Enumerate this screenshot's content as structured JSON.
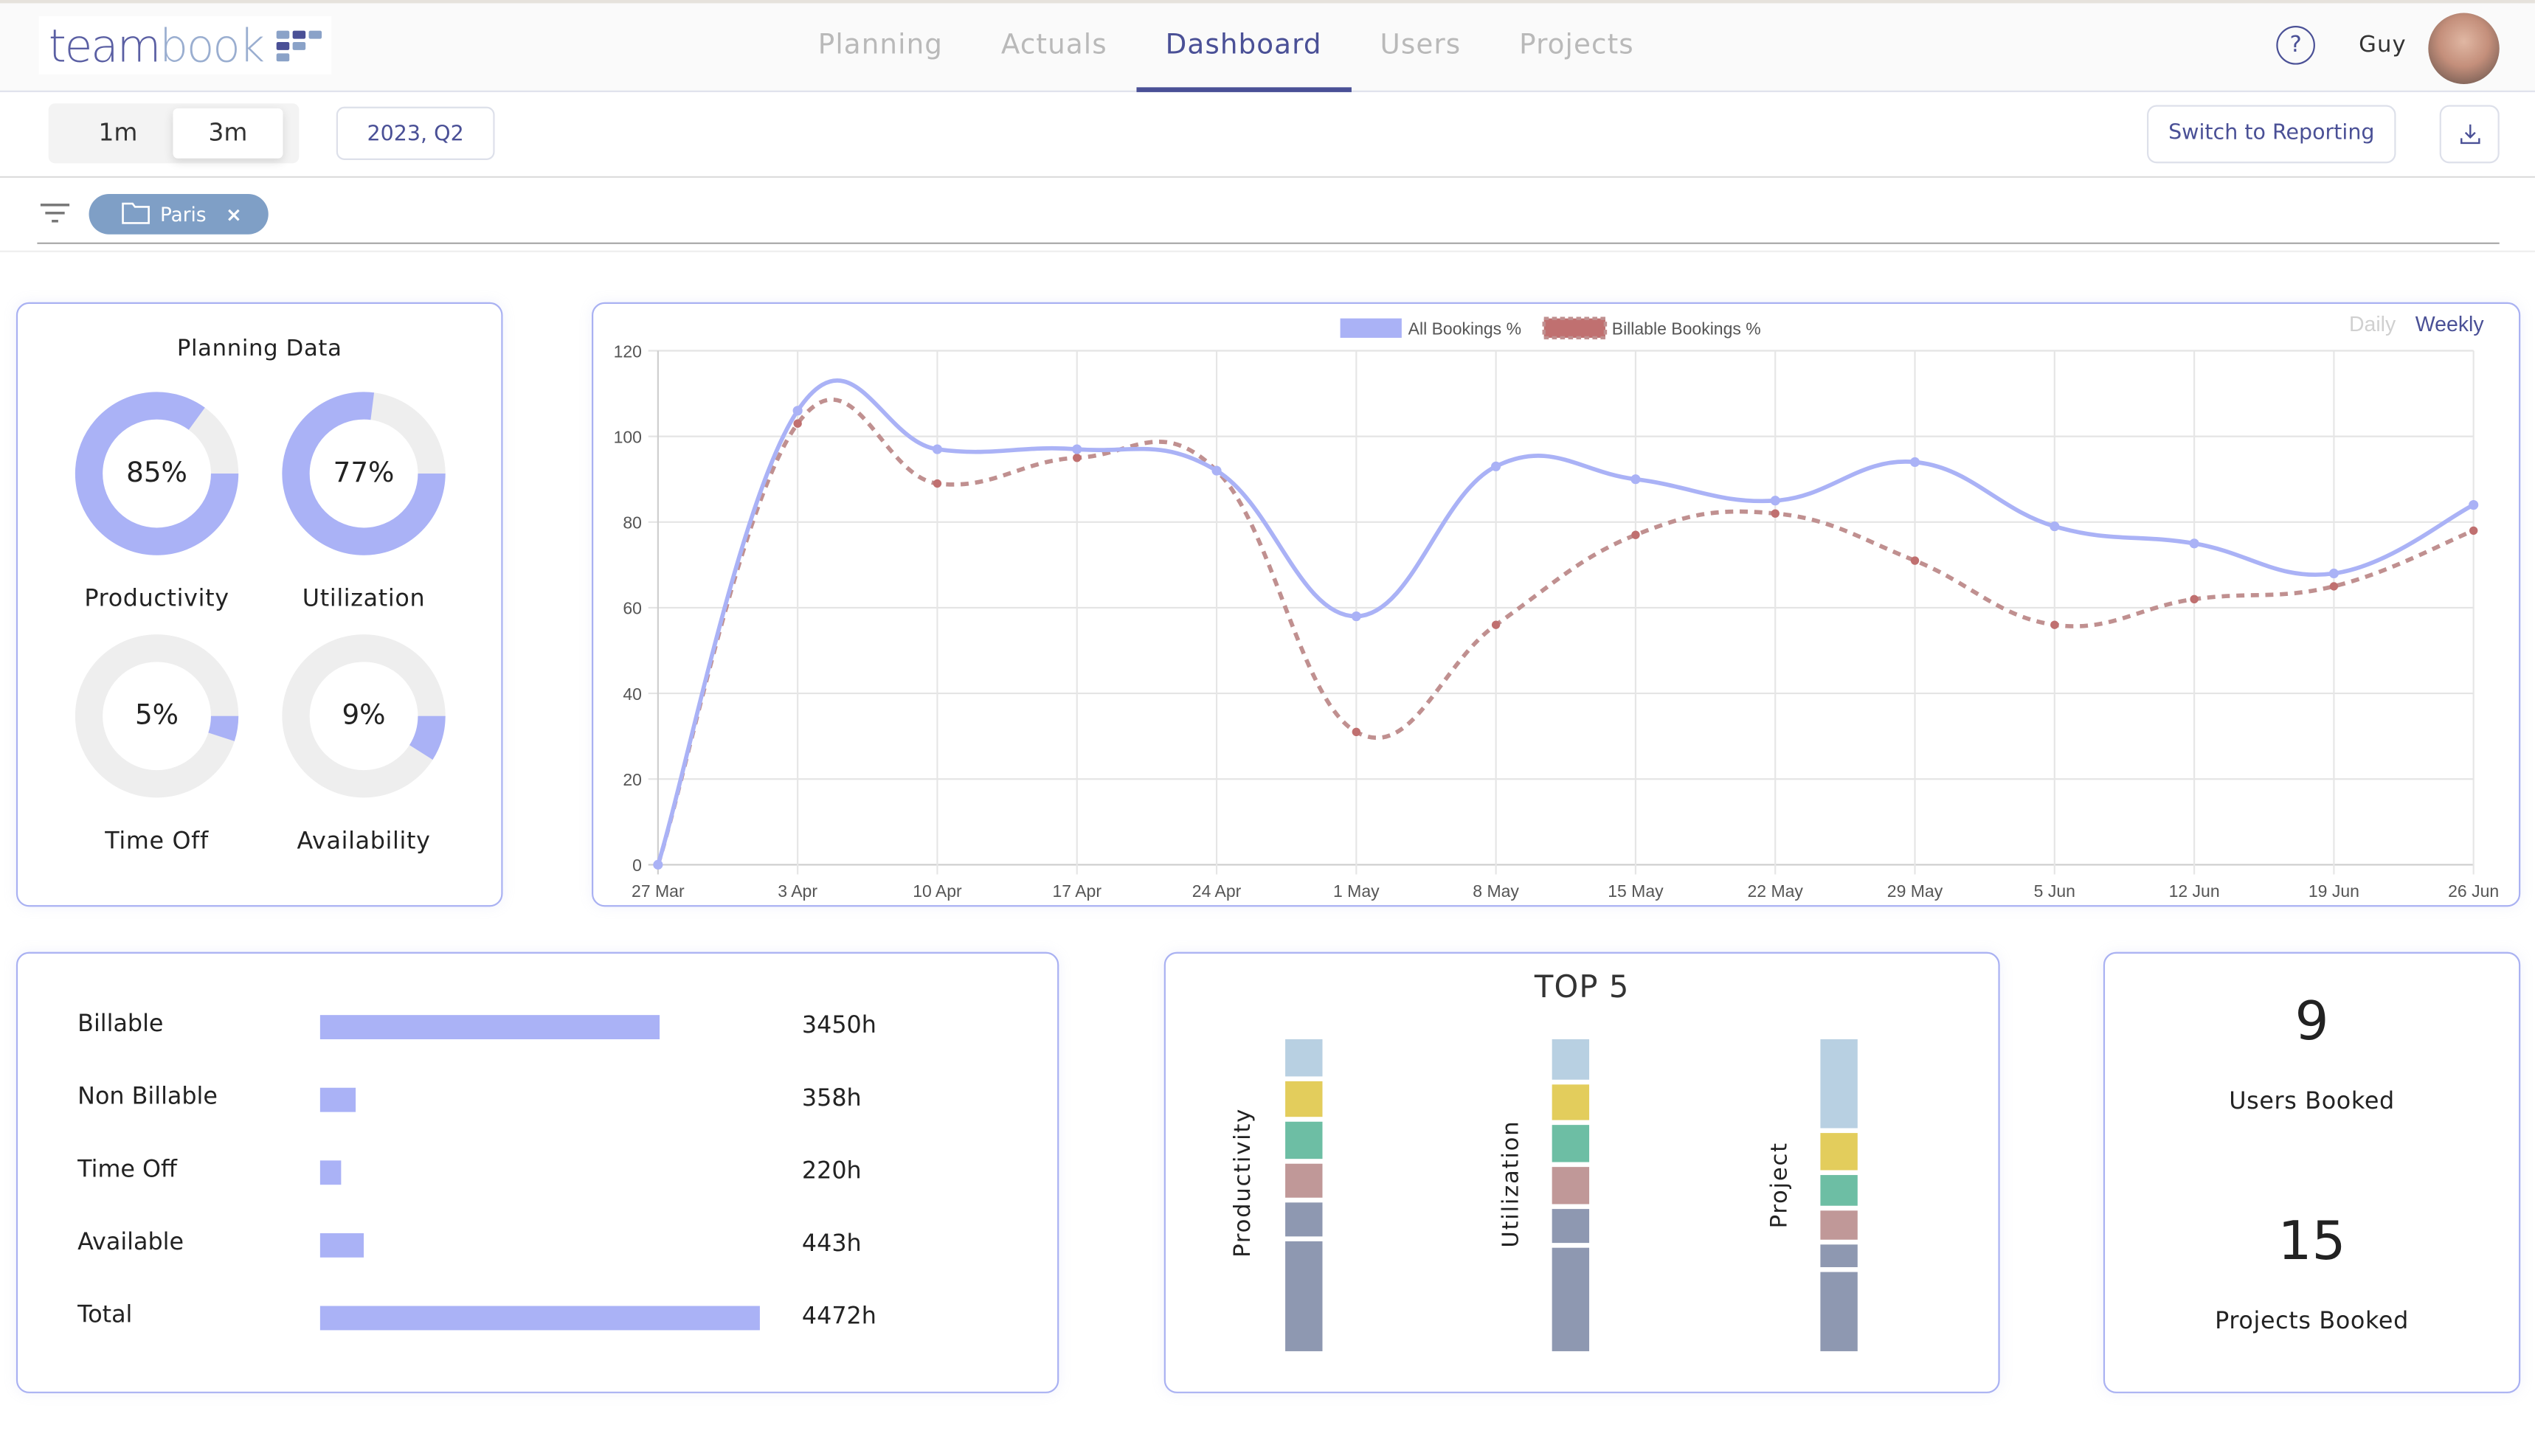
{
  "app": {
    "logo_part1": "team",
    "logo_part2": "book",
    "nav": [
      {
        "label": "Planning",
        "active": false
      },
      {
        "label": "Actuals",
        "active": false
      },
      {
        "label": "Dashboard",
        "active": true
      },
      {
        "label": "Users",
        "active": false
      },
      {
        "label": "Projects",
        "active": false
      }
    ],
    "help_icon": "?",
    "user_name": "Guy",
    "accent_color": "#4a5096"
  },
  "toolbar": {
    "range_options": [
      {
        "label": "1m",
        "selected": false
      },
      {
        "label": "3m",
        "selected": true
      }
    ],
    "period_label": "2023, Q2",
    "switch_label": "Switch to Reporting",
    "download_icon": "download-icon"
  },
  "filters": {
    "chips": [
      {
        "label": "Paris",
        "icon": "folder-icon",
        "remove": "×"
      }
    ]
  },
  "planning_data": {
    "title": "Planning Data",
    "donuts": [
      {
        "label": "Productivity",
        "value_text": "85%",
        "fraction": 0.85
      },
      {
        "label": "Utilization",
        "value_text": "77%",
        "fraction": 0.77
      },
      {
        "label": "Time Off",
        "value_text": "5%",
        "fraction": 0.05
      },
      {
        "label": "Availability",
        "value_text": "9%",
        "fraction": 0.09
      }
    ],
    "fill_color": "#aab2f6",
    "track_color": "#eeeeee"
  },
  "chart_toggle": {
    "daily": "Daily",
    "weekly": "Weekly",
    "selected": "weekly"
  },
  "chart_data": {
    "type": "line",
    "title": "",
    "xlabel": "",
    "ylabel": "",
    "x": [
      "27 Mar",
      "3 Apr",
      "10 Apr",
      "17 Apr",
      "24 Apr",
      "1 May",
      "8 May",
      "15 May",
      "22 May",
      "29 May",
      "5 Jun",
      "12 Jun",
      "19 Jun",
      "26 Jun"
    ],
    "ylim": [
      0,
      120
    ],
    "yticks": [
      0,
      20,
      40,
      60,
      80,
      100,
      120
    ],
    "grid": true,
    "legend_position": "top-center",
    "series": [
      {
        "name": "All Bookings %",
        "color": "#aab2f6",
        "dashed": false,
        "values": [
          0,
          106,
          97,
          97,
          92,
          58,
          93,
          90,
          85,
          94,
          79,
          75,
          68,
          84
        ]
      },
      {
        "name": "Billable Bookings %",
        "color": "#c09090",
        "point_color": "#c07070",
        "dashed": true,
        "values": [
          0,
          103,
          89,
          95,
          92,
          31,
          56,
          77,
          82,
          71,
          56,
          62,
          65,
          78
        ]
      }
    ]
  },
  "hours": {
    "rows": [
      {
        "label": "Billable",
        "hours": 3450,
        "value_text": "3450h"
      },
      {
        "label": "Non Billable",
        "hours": 358,
        "value_text": "358h"
      },
      {
        "label": "Time Off",
        "hours": 220,
        "value_text": "220h"
      },
      {
        "label": "Available",
        "hours": 443,
        "value_text": "443h"
      },
      {
        "label": "Total",
        "hours": 4472,
        "value_text": "4472h"
      }
    ],
    "max_hours": 4472,
    "bar_color": "#aab2f6"
  },
  "top5": {
    "title": "TOP 5",
    "segment_colors": [
      "#b8d0e2",
      "#e3cd5c",
      "#6dbea4",
      "#c09898",
      "#8e98b1",
      "#8e98b1"
    ],
    "columns": [
      {
        "label": "Productivity",
        "shares": [
          0.117,
          0.116,
          0.117,
          0.107,
          0.107,
          0.349
        ]
      },
      {
        "label": "Utilization",
        "shares": [
          0.126,
          0.116,
          0.118,
          0.116,
          0.109,
          0.329
        ]
      },
      {
        "label": "Project",
        "shares": [
          0.281,
          0.118,
          0.096,
          0.097,
          0.067,
          0.253
        ]
      }
    ]
  },
  "kpis": [
    {
      "value": "9",
      "label": "Users Booked"
    },
    {
      "value": "15",
      "label": "Projects Booked"
    }
  ]
}
